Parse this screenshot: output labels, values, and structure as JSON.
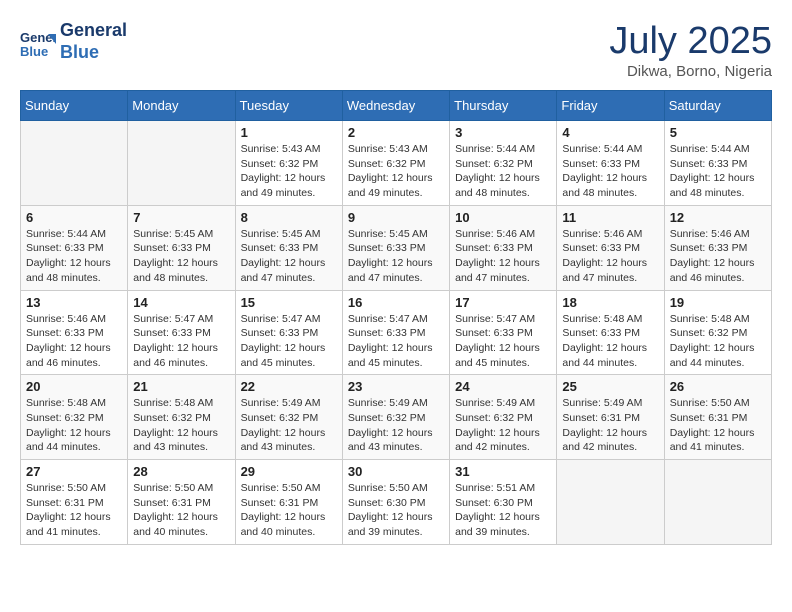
{
  "header": {
    "logo_line1": "General",
    "logo_line2": "Blue",
    "month_title": "July 2025",
    "subtitle": "Dikwa, Borno, Nigeria"
  },
  "weekdays": [
    "Sunday",
    "Monday",
    "Tuesday",
    "Wednesday",
    "Thursday",
    "Friday",
    "Saturday"
  ],
  "weeks": [
    [
      {
        "day": "",
        "info": ""
      },
      {
        "day": "",
        "info": ""
      },
      {
        "day": "1",
        "info": "Sunrise: 5:43 AM\nSunset: 6:32 PM\nDaylight: 12 hours and 49 minutes."
      },
      {
        "day": "2",
        "info": "Sunrise: 5:43 AM\nSunset: 6:32 PM\nDaylight: 12 hours and 49 minutes."
      },
      {
        "day": "3",
        "info": "Sunrise: 5:44 AM\nSunset: 6:32 PM\nDaylight: 12 hours and 48 minutes."
      },
      {
        "day": "4",
        "info": "Sunrise: 5:44 AM\nSunset: 6:33 PM\nDaylight: 12 hours and 48 minutes."
      },
      {
        "day": "5",
        "info": "Sunrise: 5:44 AM\nSunset: 6:33 PM\nDaylight: 12 hours and 48 minutes."
      }
    ],
    [
      {
        "day": "6",
        "info": "Sunrise: 5:44 AM\nSunset: 6:33 PM\nDaylight: 12 hours and 48 minutes."
      },
      {
        "day": "7",
        "info": "Sunrise: 5:45 AM\nSunset: 6:33 PM\nDaylight: 12 hours and 48 minutes."
      },
      {
        "day": "8",
        "info": "Sunrise: 5:45 AM\nSunset: 6:33 PM\nDaylight: 12 hours and 47 minutes."
      },
      {
        "day": "9",
        "info": "Sunrise: 5:45 AM\nSunset: 6:33 PM\nDaylight: 12 hours and 47 minutes."
      },
      {
        "day": "10",
        "info": "Sunrise: 5:46 AM\nSunset: 6:33 PM\nDaylight: 12 hours and 47 minutes."
      },
      {
        "day": "11",
        "info": "Sunrise: 5:46 AM\nSunset: 6:33 PM\nDaylight: 12 hours and 47 minutes."
      },
      {
        "day": "12",
        "info": "Sunrise: 5:46 AM\nSunset: 6:33 PM\nDaylight: 12 hours and 46 minutes."
      }
    ],
    [
      {
        "day": "13",
        "info": "Sunrise: 5:46 AM\nSunset: 6:33 PM\nDaylight: 12 hours and 46 minutes."
      },
      {
        "day": "14",
        "info": "Sunrise: 5:47 AM\nSunset: 6:33 PM\nDaylight: 12 hours and 46 minutes."
      },
      {
        "day": "15",
        "info": "Sunrise: 5:47 AM\nSunset: 6:33 PM\nDaylight: 12 hours and 45 minutes."
      },
      {
        "day": "16",
        "info": "Sunrise: 5:47 AM\nSunset: 6:33 PM\nDaylight: 12 hours and 45 minutes."
      },
      {
        "day": "17",
        "info": "Sunrise: 5:47 AM\nSunset: 6:33 PM\nDaylight: 12 hours and 45 minutes."
      },
      {
        "day": "18",
        "info": "Sunrise: 5:48 AM\nSunset: 6:33 PM\nDaylight: 12 hours and 44 minutes."
      },
      {
        "day": "19",
        "info": "Sunrise: 5:48 AM\nSunset: 6:32 PM\nDaylight: 12 hours and 44 minutes."
      }
    ],
    [
      {
        "day": "20",
        "info": "Sunrise: 5:48 AM\nSunset: 6:32 PM\nDaylight: 12 hours and 44 minutes."
      },
      {
        "day": "21",
        "info": "Sunrise: 5:48 AM\nSunset: 6:32 PM\nDaylight: 12 hours and 43 minutes."
      },
      {
        "day": "22",
        "info": "Sunrise: 5:49 AM\nSunset: 6:32 PM\nDaylight: 12 hours and 43 minutes."
      },
      {
        "day": "23",
        "info": "Sunrise: 5:49 AM\nSunset: 6:32 PM\nDaylight: 12 hours and 43 minutes."
      },
      {
        "day": "24",
        "info": "Sunrise: 5:49 AM\nSunset: 6:32 PM\nDaylight: 12 hours and 42 minutes."
      },
      {
        "day": "25",
        "info": "Sunrise: 5:49 AM\nSunset: 6:31 PM\nDaylight: 12 hours and 42 minutes."
      },
      {
        "day": "26",
        "info": "Sunrise: 5:50 AM\nSunset: 6:31 PM\nDaylight: 12 hours and 41 minutes."
      }
    ],
    [
      {
        "day": "27",
        "info": "Sunrise: 5:50 AM\nSunset: 6:31 PM\nDaylight: 12 hours and 41 minutes."
      },
      {
        "day": "28",
        "info": "Sunrise: 5:50 AM\nSunset: 6:31 PM\nDaylight: 12 hours and 40 minutes."
      },
      {
        "day": "29",
        "info": "Sunrise: 5:50 AM\nSunset: 6:31 PM\nDaylight: 12 hours and 40 minutes."
      },
      {
        "day": "30",
        "info": "Sunrise: 5:50 AM\nSunset: 6:30 PM\nDaylight: 12 hours and 39 minutes."
      },
      {
        "day": "31",
        "info": "Sunrise: 5:51 AM\nSunset: 6:30 PM\nDaylight: 12 hours and 39 minutes."
      },
      {
        "day": "",
        "info": ""
      },
      {
        "day": "",
        "info": ""
      }
    ]
  ]
}
